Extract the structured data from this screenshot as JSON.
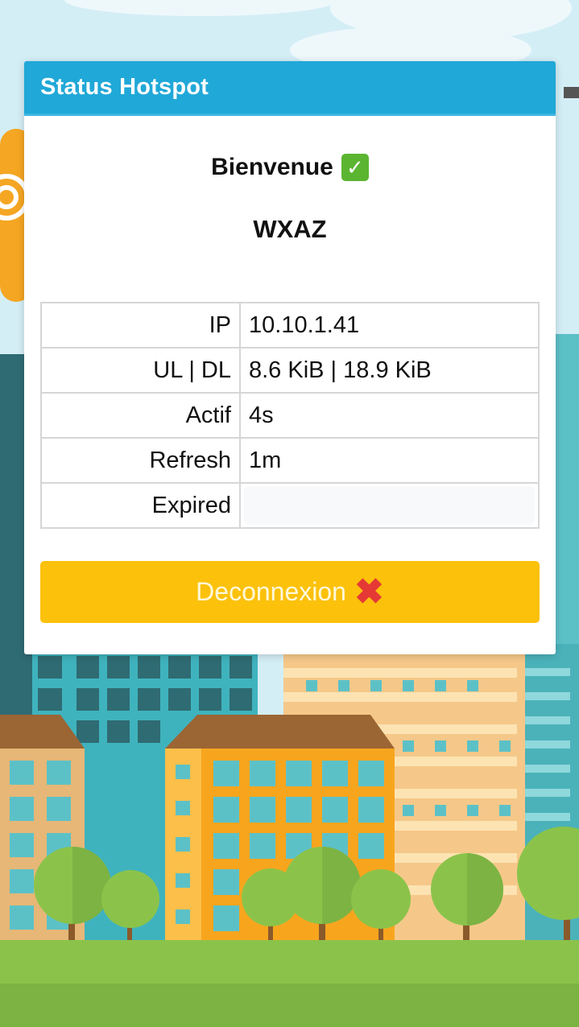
{
  "card": {
    "title": "Status Hotspot",
    "welcome_text": "Bienvenue",
    "welcome_icon": "check-mark-icon",
    "username": "WXAZ"
  },
  "status_rows": [
    {
      "label": "IP",
      "value": "10.10.1.41"
    },
    {
      "label": "UL | DL",
      "value": "8.6 KiB | 18.9 KiB"
    },
    {
      "label": "Actif",
      "value": "4s"
    },
    {
      "label": "Refresh",
      "value": "1m"
    },
    {
      "label": "Expired",
      "value": ""
    }
  ],
  "logout": {
    "label": "Deconnexion",
    "icon": "cross-mark-icon"
  },
  "colors": {
    "header": "#20a8d8",
    "button": "#fcc10b",
    "grass": "#8bc34a"
  }
}
